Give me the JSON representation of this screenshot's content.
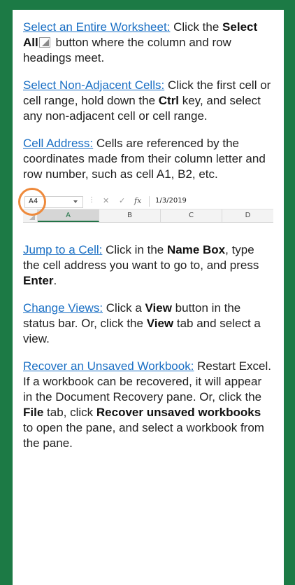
{
  "tips": [
    {
      "heading": "Select an Entire Worksheet:",
      "pre": " Click the ",
      "bold1": "Select All",
      "mid": " button where the column and row headings meet."
    },
    {
      "heading": "Select Non-Adjacent Cells:",
      "pre": " Click the first cell or cell range, hold down the ",
      "bold1": "Ctrl",
      "post": " key, and select any non-adjacent cell or cell range."
    },
    {
      "heading": "Cell Address:",
      "text": " Cells are referenced by the coordinates made from their column letter and row number, such as cell A1, B2, etc."
    },
    {
      "heading": "Jump to a Cell:",
      "pre": " Click in the ",
      "bold1": "Name Box",
      "mid": ", type the cell address you want to go to, and press ",
      "bold2": "Enter",
      "post": "."
    },
    {
      "heading": "Change Views:",
      "pre": " Click a ",
      "bold1": "View",
      "mid": " button in the status bar. Or, click the ",
      "bold2": "View",
      "post": " tab and select a view."
    },
    {
      "heading": "Recover an Unsaved Workbook:",
      "pre": " Restart Excel. If a workbook can be recovered, it will appear in the Document Recovery pane. Or, click the ",
      "bold1": "File",
      "mid": " tab, click ",
      "bold2": "Recover unsaved workbooks",
      "post": " to open the pane, and select a workbook from the pane."
    }
  ],
  "excel": {
    "name_box": "A4",
    "formula_value": "1/3/2019",
    "fx_label": "fx",
    "columns": [
      "A",
      "B",
      "C",
      "D"
    ]
  },
  "colors": {
    "border_green": "#1c7a45",
    "heading_blue": "#1a6fc4",
    "highlight_orange": "#ee8a3c"
  }
}
